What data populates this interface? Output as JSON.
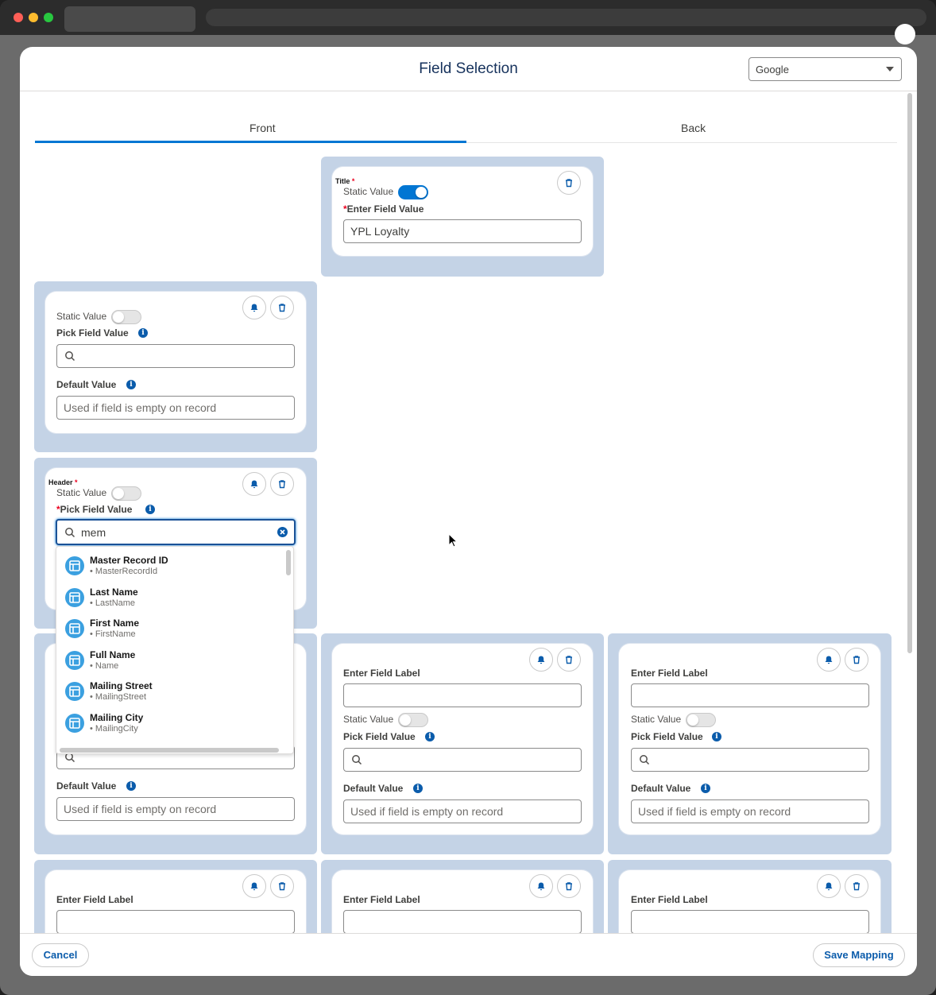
{
  "modal": {
    "title": "Field Selection",
    "provider_select": "Google"
  },
  "tabs": {
    "front": "Front",
    "back": "Back",
    "active": "Front"
  },
  "title_card": {
    "label": "Title",
    "static_value_label": "Static Value",
    "static_on": true,
    "field_label": "Enter Field Value",
    "field_value": "YPL Loyalty"
  },
  "card_a": {
    "static_value_label": "Static Value",
    "pick_label": "Pick Field Value",
    "default_label": "Default Value",
    "default_placeholder": "Used if field is empty on record"
  },
  "header_card": {
    "label": "Header",
    "static_value_label": "Static Value",
    "pick_label": "Pick Field Value",
    "search_value": "mem"
  },
  "dropdown": {
    "items": [
      {
        "title": "Master Record ID",
        "api": "• MasterRecordId"
      },
      {
        "title": "Last Name",
        "api": "• LastName"
      },
      {
        "title": "First Name",
        "api": "• FirstName"
      },
      {
        "title": "Full Name",
        "api": "• Name"
      },
      {
        "title": "Mailing Street",
        "api": "• MailingStreet"
      },
      {
        "title": "Mailing City",
        "api": "• MailingCity"
      }
    ]
  },
  "card_b": {
    "default_label": "Default Value",
    "default_placeholder": "Used if field is empty on record"
  },
  "card_c": {
    "label_label": "Enter Field Label",
    "static_value_label": "Static Value",
    "pick_label": "Pick Field Value",
    "default_label": "Default Value",
    "default_placeholder": "Used if field is empty on record"
  },
  "card_d": {
    "label_label": "Enter Field Label",
    "static_value_label": "Static Value",
    "pick_label": "Pick Field Value",
    "default_label": "Default Value",
    "default_placeholder": "Used if field is empty on record"
  },
  "row4": {
    "label_label": "Enter Field Label"
  },
  "footer": {
    "cancel": "Cancel",
    "save": "Save Mapping"
  },
  "colors": {
    "brand": "#0176d3",
    "slot": "#c4d3e6",
    "title": "#16325c"
  },
  "icons": [
    "search-icon",
    "bell-icon",
    "trash-icon",
    "info-icon",
    "clear-icon",
    "table-icon",
    "chevron-down-icon"
  ]
}
